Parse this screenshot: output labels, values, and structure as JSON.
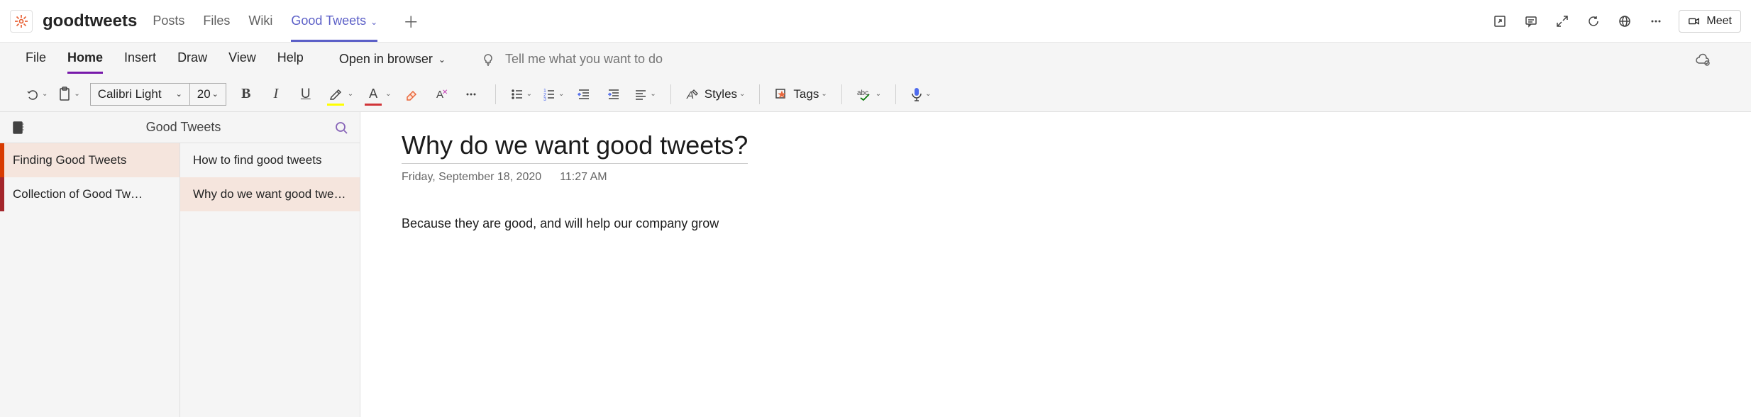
{
  "header": {
    "team_name": "goodtweets",
    "tabs": [
      "Posts",
      "Files",
      "Wiki",
      "Good Tweets"
    ],
    "active_tab_index": 3,
    "meet_label": "Meet"
  },
  "ribbon": {
    "tabs": [
      "File",
      "Home",
      "Insert",
      "Draw",
      "View",
      "Help"
    ],
    "active_tab_index": 1,
    "open_in_browser": "Open in browser",
    "tell_me_placeholder": "Tell me what you want to do"
  },
  "toolbar": {
    "font_name": "Calibri Light",
    "font_size": "20",
    "styles_label": "Styles",
    "tags_label": "Tags"
  },
  "sidebar": {
    "notebook_title": "Good Tweets",
    "sections": [
      "Finding Good Tweets",
      "Collection of Good Tw…"
    ],
    "selected_section_index": 0,
    "pages": [
      "How to find good tweets",
      "Why do we want good twe…"
    ],
    "selected_page_index": 1
  },
  "document": {
    "title": "Why do we want good tweets?",
    "date": "Friday, September 18, 2020",
    "time": "11:27 AM",
    "body": "Because they are good, and will help our company grow"
  }
}
